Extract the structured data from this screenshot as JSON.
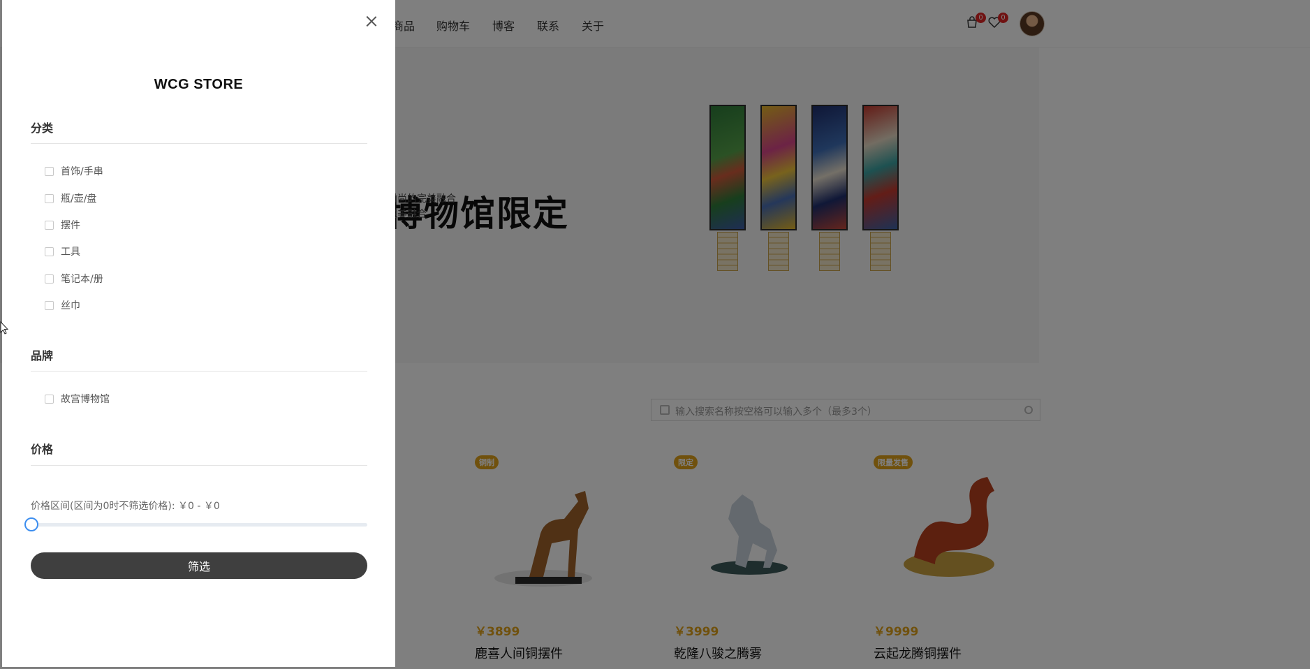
{
  "nav": {
    "links": [
      "商品",
      "购物车",
      "博客",
      "联系",
      "关于"
    ],
    "cart_count": "0",
    "wishlist_count": "0",
    "icons": [
      "cart-icon",
      "heart-icon",
      "avatar"
    ]
  },
  "hero": {
    "title": "博物馆限定",
    "subtitle_line1": "时尚的完美融合",
    "subtitle_line2": "完美融合"
  },
  "search": {
    "placeholder": "输入搜索名称按空格可以输入多个（最多3个）"
  },
  "products": [
    {
      "tag": "铜制",
      "price": "￥3899",
      "name": "鹿喜人间铜摆件"
    },
    {
      "tag": "限定",
      "price": "￥3999",
      "name": "乾隆八骏之腾雾"
    },
    {
      "tag": "限量发售",
      "price": "￥9999",
      "name": "云起龙腾铜摆件"
    }
  ],
  "drawer": {
    "store_title": "WCG STORE",
    "category_title": "分类",
    "categories": [
      "首饰/手串",
      "瓶/壶/盘",
      "摆件",
      "工具",
      "笔记本/册",
      "丝巾"
    ],
    "brand_title": "品牌",
    "brands": [
      "故宫博物馆"
    ],
    "price_title": "价格",
    "price_range_text": "价格区间(区间为0时不筛选价格): ￥0 - ￥0",
    "price_min": 0,
    "price_max": 0,
    "filter_button": "筛选"
  },
  "colors": {
    "accent": "#e0a21a",
    "button": "#3f3f3f",
    "slider_handle": "#3d8eef",
    "badge": "#e02424"
  }
}
